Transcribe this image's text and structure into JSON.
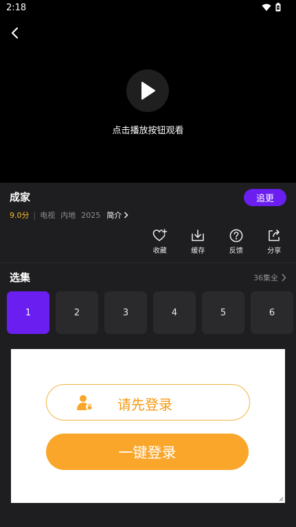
{
  "status_bar": {
    "time": "2:18"
  },
  "player": {
    "hint": "点击播放按钮观看"
  },
  "show": {
    "title": "成家",
    "follow_label": "追更",
    "score": "9.0分",
    "separator": "|",
    "tags": [
      "电视",
      "内地",
      "2025"
    ],
    "intro_label": "简介"
  },
  "actions": [
    {
      "label": "收藏",
      "icon": "heart-plus-icon"
    },
    {
      "label": "缓存",
      "icon": "download-icon"
    },
    {
      "label": "反馈",
      "icon": "question-icon"
    },
    {
      "label": "分享",
      "icon": "share-icon"
    }
  ],
  "episodes": {
    "section_title": "选集",
    "all_label": "36集全",
    "items": [
      "1",
      "2",
      "3",
      "4",
      "5",
      "6"
    ],
    "active_index": 0
  },
  "login": {
    "prompt_label": "请先登录",
    "one_key_label": "一键登录"
  },
  "colors": {
    "accent": "#6a1ef0",
    "score": "#f5c024",
    "login_orange": "#f9a62a"
  }
}
